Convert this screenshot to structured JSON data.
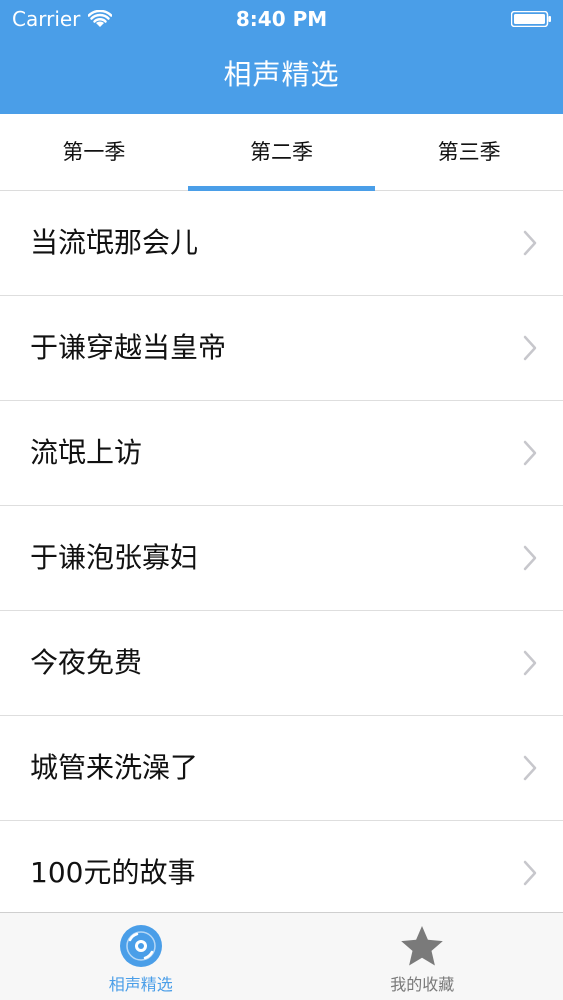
{
  "status_bar": {
    "carrier": "Carrier",
    "time": "8:40 PM",
    "wifi_icon": "wifi-icon",
    "battery_icon": "battery-icon"
  },
  "nav": {
    "title": "相声精选"
  },
  "tabs": [
    {
      "label": "第一季",
      "selected": false
    },
    {
      "label": "第二季",
      "selected": true
    },
    {
      "label": "第三季",
      "selected": false
    }
  ],
  "list": [
    {
      "label": "当流氓那会儿",
      "icon": "chevron-right-icon"
    },
    {
      "label": "于谦穿越当皇帝",
      "icon": "chevron-right-icon"
    },
    {
      "label": "流氓上访",
      "icon": "chevron-right-icon"
    },
    {
      "label": "于谦泡张寡妇",
      "icon": "chevron-right-icon"
    },
    {
      "label": "今夜免费",
      "icon": "chevron-right-icon"
    },
    {
      "label": "城管来洗澡了",
      "icon": "chevron-right-icon"
    },
    {
      "label": "100元的故事",
      "icon": "chevron-right-icon"
    }
  ],
  "tabbar": [
    {
      "label": "相声精选",
      "icon": "disc-icon",
      "active": true
    },
    {
      "label": "我的收藏",
      "icon": "star-icon",
      "active": false
    }
  ],
  "colors": {
    "accent": "#4a9ee8",
    "inactive": "#7a7a7a",
    "divider": "#dedede"
  }
}
